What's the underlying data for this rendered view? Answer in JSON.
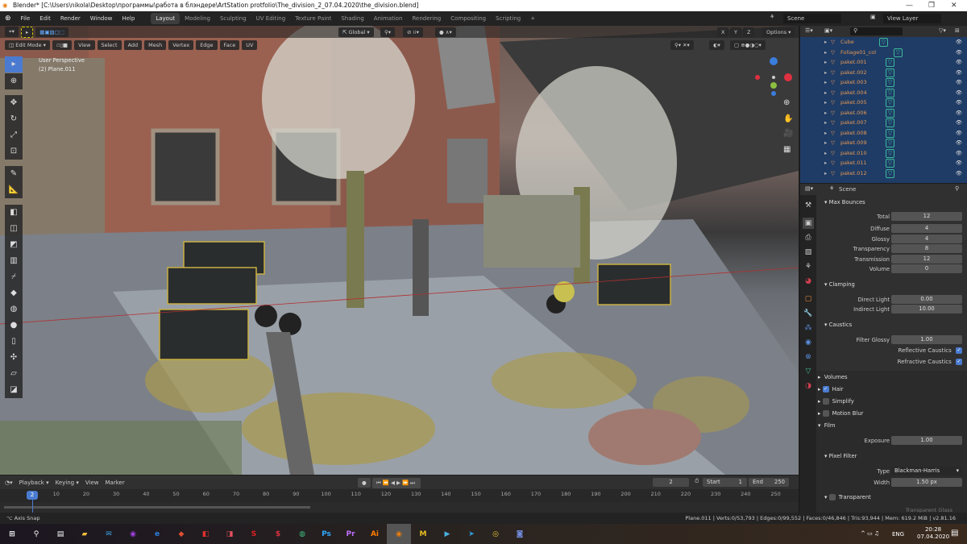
{
  "window": {
    "title": "Blender* [C:\\Users\\nikola\\Desktop\\программы\\работа в блэндере\\ArtStation protfolio\\The_division_2_07.04.2020\\the_division.blend]",
    "minimize": "—",
    "maximize": "❐",
    "close": "✕"
  },
  "menu": [
    "File",
    "Edit",
    "Render",
    "Window",
    "Help"
  ],
  "workspaces": [
    {
      "label": "Layout",
      "active": true
    },
    {
      "label": "Modeling"
    },
    {
      "label": "Sculpting"
    },
    {
      "label": "UV Editing"
    },
    {
      "label": "Texture Paint"
    },
    {
      "label": "Shading"
    },
    {
      "label": "Animation"
    },
    {
      "label": "Rendering"
    },
    {
      "label": "Compositing"
    },
    {
      "label": "Scripting"
    }
  ],
  "scene": {
    "name": "Scene",
    "view_layer": "View Layer"
  },
  "viewport": {
    "mode": "Edit Mode",
    "menus": [
      "View",
      "Select",
      "Add",
      "Mesh",
      "Vertex",
      "Edge",
      "Face",
      "UV"
    ],
    "orientation": "Global",
    "axes": [
      "X",
      "Y",
      "Z"
    ],
    "options": "Options",
    "overlay_line1": "User Perspective",
    "overlay_line2": "(2) Plane.011"
  },
  "outliner": {
    "items": [
      {
        "name": "Cube"
      },
      {
        "name": "Foliage01_col"
      },
      {
        "name": "paket.001"
      },
      {
        "name": "paket.002"
      },
      {
        "name": "paket.003"
      },
      {
        "name": "paket.004"
      },
      {
        "name": "paket.005"
      },
      {
        "name": "paket.006"
      },
      {
        "name": "paket.007"
      },
      {
        "name": "paket.008"
      },
      {
        "name": "paket.009"
      },
      {
        "name": "paket.010"
      },
      {
        "name": "paket.011"
      },
      {
        "name": "paket.012"
      }
    ]
  },
  "properties": {
    "context": "Scene",
    "max_bounces": {
      "title": "Max Bounces",
      "total": "12",
      "diffuse": "4",
      "glossy": "4",
      "transparency": "8",
      "transmission": "12",
      "volume": "0",
      "labels": [
        "Total",
        "Diffuse",
        "Glossy",
        "Transparency",
        "Transmission",
        "Volume"
      ]
    },
    "clamping": {
      "title": "Clamping",
      "direct_label": "Direct Light",
      "direct": "0.00",
      "indirect_label": "Indirect Light",
      "indirect": "10.00"
    },
    "caustics": {
      "title": "Caustics",
      "filter_label": "Filter Glossy",
      "filter": "1.00",
      "reflective": "Reflective Caustics",
      "refractive": "Refractive Caustics"
    },
    "volumes": "Volumes",
    "hair": "Hair",
    "simplify": "Simplify",
    "motion_blur": "Motion Blur",
    "film": {
      "title": "Film",
      "exposure_label": "Exposure",
      "exposure": "1.00",
      "pixel_filter": "Pixel Filter",
      "type_label": "Type",
      "type": "Blackman-Harris",
      "width_label": "Width",
      "width": "1.50 px",
      "transparent": "Transparent",
      "transparent_glass": "Transparent Glass"
    }
  },
  "timeline": {
    "menus": [
      "Playback",
      "Keying",
      "View",
      "Marker"
    ],
    "current_frame": "2",
    "start_label": "Start",
    "start": "1",
    "end_label": "End",
    "end": "250",
    "ticks": [
      "10",
      "20",
      "30",
      "40",
      "50",
      "60",
      "70",
      "80",
      "90",
      "100",
      "110",
      "120",
      "130",
      "140",
      "150",
      "160",
      "170",
      "180",
      "190",
      "200",
      "210",
      "220",
      "230",
      "240",
      "250"
    ]
  },
  "status": {
    "left": "Axis Snap",
    "right": "Plane.011 | Verts:0/53,793 | Edges:0/99,552 | Faces:0/46,846 | Tris:93,944 | Mem: 619.2 MiB | v2.81.16"
  },
  "taskbar": {
    "apps": [
      "Ps",
      "Pr",
      "Ai",
      "M"
    ],
    "lang": "ENG",
    "time": "20:28",
    "date": "07.04.2020"
  },
  "colors": {
    "accent": "#4a7bd0",
    "outliner_bg": "#1f3c66",
    "object_name": "#e59854"
  }
}
